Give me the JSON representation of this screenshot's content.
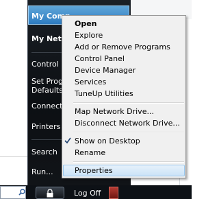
{
  "start_menu": {
    "right_items": [
      {
        "label": "My Comp",
        "bold": true
      },
      {
        "label": "My Netw",
        "bold": true
      },
      {
        "label": "Control",
        "bold": false
      },
      {
        "label": "Set Prog",
        "bold": false
      },
      {
        "label": "Defaults",
        "bold": false
      },
      {
        "label": "Connect",
        "bold": false
      },
      {
        "label": "Printers",
        "bold": false
      },
      {
        "label": "Search",
        "bold": false
      },
      {
        "label": "Run...",
        "bold": false
      }
    ],
    "log_off_label": "Log Off",
    "icons": {
      "search": "magnifier-icon",
      "lock": "lock-icon",
      "shutdown": "power-icon"
    }
  },
  "context_menu": {
    "items": [
      {
        "label": "Open",
        "bold": true
      },
      {
        "label": "Explore"
      },
      {
        "label": "Add or Remove Programs"
      },
      {
        "label": "Control Panel"
      },
      {
        "label": "Device Manager"
      },
      {
        "label": "Services"
      },
      {
        "label": "TuneUp Utilities"
      },
      {
        "label": "Map Network Drive..."
      },
      {
        "label": "Disconnect Network Drive..."
      },
      {
        "label": "Show on Desktop",
        "checked": true
      },
      {
        "label": "Rename"
      },
      {
        "label": "Properties",
        "highlighted": true
      }
    ]
  },
  "colors": {
    "highlight": "#cbe3f7",
    "start_highlight": "#2e7cc1",
    "start_bg": "#0c0f13",
    "menu_bg": "#f0f0f0"
  }
}
